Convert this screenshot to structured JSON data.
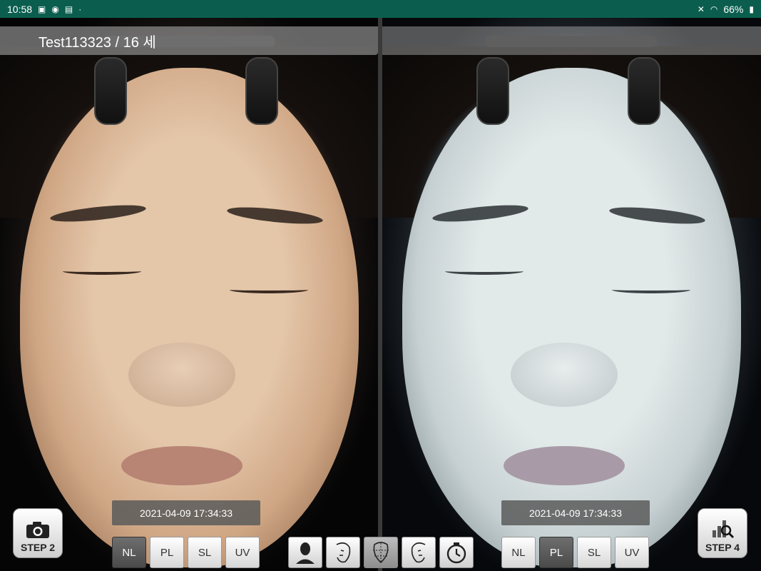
{
  "status_bar": {
    "time": "10:58",
    "battery": "66%",
    "icons": [
      "image-icon",
      "chrome-icon",
      "shopping-bag-icon",
      "dot-icon",
      "mute-icon",
      "wifi-icon",
      "battery-icon"
    ]
  },
  "patient": {
    "label": "Test113323 / 16 세"
  },
  "left_panel": {
    "timestamp": "2021-04-09 17:34:33",
    "modes": [
      "NL",
      "PL",
      "SL",
      "UV"
    ],
    "active_mode": "NL"
  },
  "right_panel": {
    "timestamp": "2021-04-09 17:34:33",
    "modes": [
      "NL",
      "PL",
      "SL",
      "UV"
    ],
    "active_mode": "PL"
  },
  "steps": {
    "left_label": "STEP 2",
    "right_label": "STEP 4"
  },
  "tools": [
    "front-face-icon",
    "left-face-icon",
    "grid-face-icon",
    "right-face-icon",
    "timer-icon"
  ],
  "colors": {
    "status_bar": "#0b5e4e",
    "active_mode": "#5a5a5a"
  }
}
